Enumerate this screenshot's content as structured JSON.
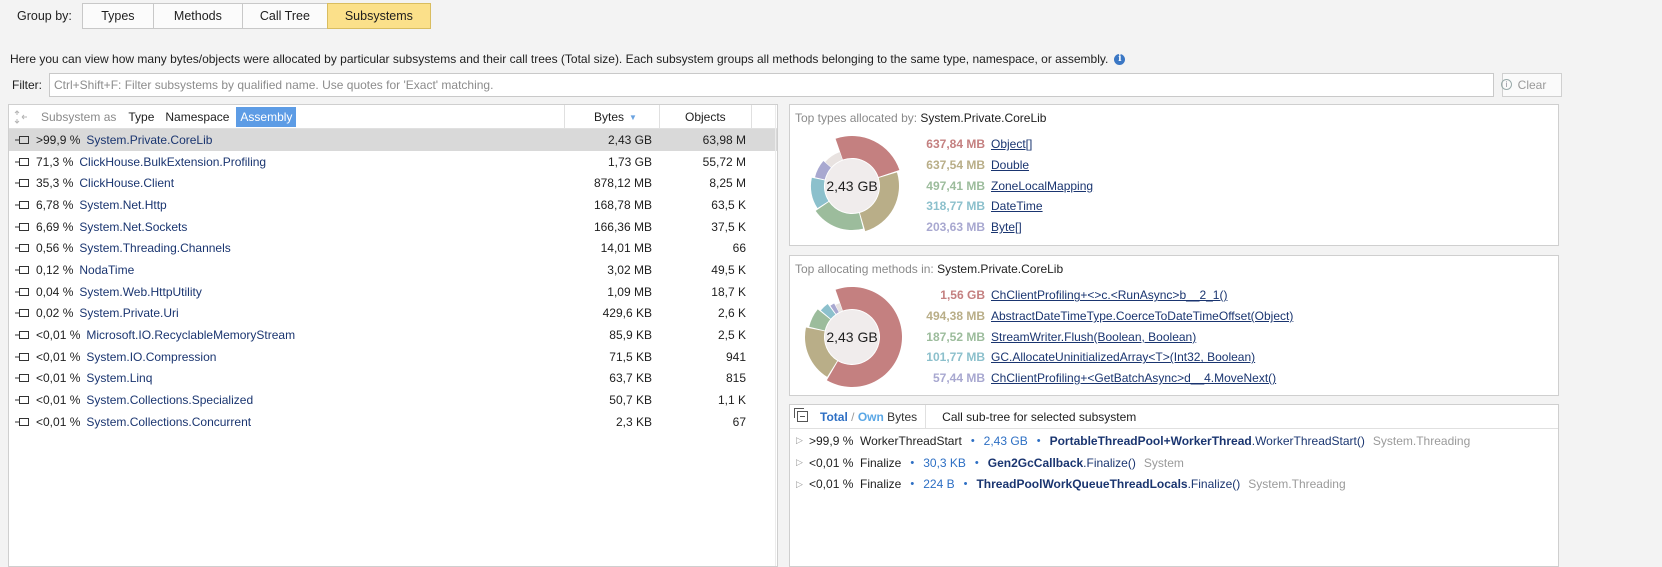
{
  "group_by": {
    "label": "Group by:",
    "options": [
      "Types",
      "Methods",
      "Call Tree",
      "Subsystems"
    ],
    "active": "Subsystems"
  },
  "description": "Here you can view how many bytes/objects were allocated by particular subsystems and their call trees (Total size). Each subsystem groups all methods belonging to the same type, namespace, or assembly.",
  "filter": {
    "label": "Filter:",
    "placeholder": "Ctrl+Shift+F: Filter subsystems by qualified name. Use quotes for 'Exact' matching.",
    "value": "",
    "clear_label": "Clear"
  },
  "subsystems_table": {
    "subsystem_as_label": "Subsystem as",
    "as_options": [
      "Type",
      "Namespace",
      "Assembly"
    ],
    "as_active": "Assembly",
    "col_bytes": "Bytes",
    "col_objects": "Objects",
    "rows": [
      {
        "pct": ">99,9 %",
        "name": "System.Private.CoreLib",
        "bytes": "2,43 GB",
        "objects": "63,98 M",
        "selected": true
      },
      {
        "pct": "71,3 %",
        "name": "ClickHouse.BulkExtension.Profiling",
        "bytes": "1,73 GB",
        "objects": "55,72 M"
      },
      {
        "pct": "35,3 %",
        "name": "ClickHouse.Client",
        "bytes": "878,12 MB",
        "objects": "8,25 M"
      },
      {
        "pct": "6,78 %",
        "name": "System.Net.Http",
        "bytes": "168,78 MB",
        "objects": "63,5 K"
      },
      {
        "pct": "6,69 %",
        "name": "System.Net.Sockets",
        "bytes": "166,36 MB",
        "objects": "37,5 K"
      },
      {
        "pct": "0,56 %",
        "name": "System.Threading.Channels",
        "bytes": "14,01 MB",
        "objects": "66"
      },
      {
        "pct": "0,12 %",
        "name": "NodaTime",
        "bytes": "3,02 MB",
        "objects": "49,5 K"
      },
      {
        "pct": "0,04 %",
        "name": "System.Web.HttpUtility",
        "bytes": "1,09 MB",
        "objects": "18,7 K"
      },
      {
        "pct": "0,02 %",
        "name": "System.Private.Uri",
        "bytes": "429,6 KB",
        "objects": "2,6 K"
      },
      {
        "pct": "<0,01 %",
        "name": "Microsoft.IO.RecyclableMemoryStream",
        "bytes": "85,9 KB",
        "objects": "2,5 K"
      },
      {
        "pct": "<0,01 %",
        "name": "System.IO.Compression",
        "bytes": "71,5 KB",
        "objects": "941"
      },
      {
        "pct": "<0,01 %",
        "name": "System.Linq",
        "bytes": "63,7 KB",
        "objects": "815"
      },
      {
        "pct": "<0,01 %",
        "name": "System.Collections.Specialized",
        "bytes": "50,7 KB",
        "objects": "1,1 K"
      },
      {
        "pct": "<0,01 %",
        "name": "System.Collections.Concurrent",
        "bytes": "2,3 KB",
        "objects": "67"
      }
    ]
  },
  "top_types": {
    "title_prefix": "Top types allocated by:",
    "title_subject": "System.Private.CoreLib",
    "center_label": "2,43 GB",
    "items": [
      {
        "size": "637,84 MB",
        "name": "Object[]",
        "color": "#c48080"
      },
      {
        "size": "637,54 MB",
        "name": "Double",
        "color": "#b9ae88"
      },
      {
        "size": "497,41 MB",
        "name": "ZoneLocalMapping",
        "color": "#9cbc9c"
      },
      {
        "size": "318,77 MB",
        "name": "DateTime",
        "color": "#8cc0cc"
      },
      {
        "size": "203,63 MB",
        "name": "Byte[]",
        "color": "#a8a8d0"
      }
    ]
  },
  "top_methods": {
    "title_prefix": "Top allocating methods in:",
    "title_subject": "System.Private.CoreLib",
    "center_label": "2,43 GB",
    "items": [
      {
        "size": "1,56 GB",
        "name": "ChClientProfiling+<>c.<RunAsync>b__2_1()",
        "color": "#c48080"
      },
      {
        "size": "494,38 MB",
        "name": "AbstractDateTimeType.CoerceToDateTimeOffset(Object)",
        "color": "#b9ae88"
      },
      {
        "size": "187,52 MB",
        "name": "StreamWriter.Flush(Boolean, Boolean)",
        "color": "#9cbc9c"
      },
      {
        "size": "101,77 MB",
        "name": "GC.AllocateUninitializedArray<T>(Int32, Boolean)",
        "color": "#8cc0cc"
      },
      {
        "size": "57,44 MB",
        "name": "ChClientProfiling+<GetBatchAsync>d__4.MoveNext()",
        "color": "#a8a8d0"
      }
    ]
  },
  "call_tree": {
    "total_label": "Total",
    "slash": "/",
    "own_label": "Own",
    "bytes_label": "Bytes",
    "caption": "Call sub-tree for selected subsystem",
    "rows": [
      {
        "pct": ">99,9 %",
        "func": "WorkerThreadStart",
        "size": "2,43 GB",
        "cls": "PortableThreadPool+WorkerThread",
        "method": ".WorkerThreadStart()",
        "ns": "System.Threading"
      },
      {
        "pct": "<0,01 %",
        "func": "Finalize",
        "size": "30,3 KB",
        "cls": "Gen2GcCallback",
        "method": ".Finalize()",
        "ns": "System"
      },
      {
        "pct": "<0,01 %",
        "func": "Finalize",
        "size": "224 B",
        "cls": "ThreadPoolWorkQueueThreadLocals",
        "method": ".Finalize()",
        "ns": "System.Threading"
      }
    ]
  }
}
